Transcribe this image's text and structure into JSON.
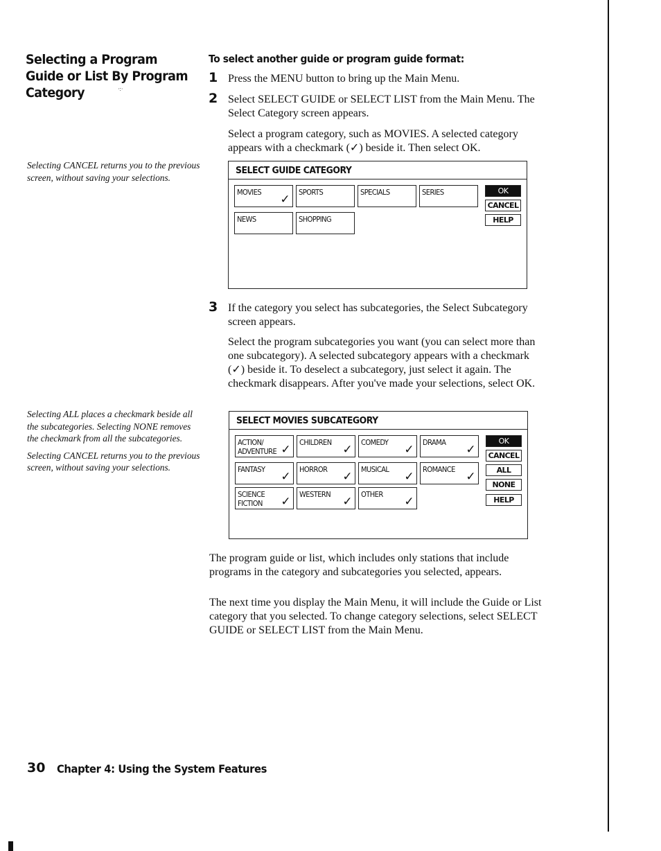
{
  "sidebar": {
    "title": "Selecting a Program Guide or List By Program Category",
    "note_cancel_1": "Selecting CANCEL returns you to the previous screen, without saving your selections.",
    "note_all_none": "Selecting ALL places a checkmark beside all the subcategories. Selecting NONE removes the checkmark from all the subcategories.",
    "note_cancel_2": "Selecting CANCEL returns you to the previous screen, without saving your selections."
  },
  "main": {
    "subhead": "To select another guide or program guide format:",
    "steps": [
      {
        "num": "1",
        "text": "Press the MENU button to bring up the Main Menu."
      },
      {
        "num": "2",
        "text": "Select SELECT GUIDE or SELECT LIST from the Main Menu. The Select Category screen appears."
      },
      {
        "num": "3",
        "text": "If the category you select has subcategories, the Select Subcategory screen appears."
      }
    ],
    "step2_detail": "Select a program category, such as MOVIES. A selected category appears with a checkmark (✓) beside it. Then select OK.",
    "step3_detail": "Select the program subcategories you want (you can select more than one subcategory). A selected subcategory appears with a checkmark (✓) beside it. To deselect a subcategory, just select it again. The checkmark disappears. After you've made your selections, select OK.",
    "result_text": "The program guide or list, which includes only stations that include programs in the category and subcategories you selected, appears.",
    "next_time_text": "The next time you display the Main Menu, it will include the Guide or List category that you selected. To change category selections, select SELECT GUIDE or SELECT LIST from the Main Menu."
  },
  "guide_screen": {
    "title": "SELECT GUIDE CATEGORY",
    "categories": [
      {
        "label": "MOVIES",
        "checked": true
      },
      {
        "label": "SPORTS",
        "checked": false
      },
      {
        "label": "SPECIALS",
        "checked": false
      },
      {
        "label": "SERIES",
        "checked": false
      },
      {
        "label": "NEWS",
        "checked": false
      },
      {
        "label": "SHOPPING",
        "checked": false
      }
    ],
    "buttons": {
      "ok": "OK",
      "cancel": "CANCEL",
      "help": "HELP"
    }
  },
  "subcategory_screen": {
    "title": "SELECT MOVIES SUBCATEGORY",
    "subcategories": [
      {
        "label": "ACTION/\nADVENTURE",
        "checked": true
      },
      {
        "label": "CHILDREN",
        "checked": true
      },
      {
        "label": "COMEDY",
        "checked": true
      },
      {
        "label": "DRAMA",
        "checked": true
      },
      {
        "label": "FANTASY",
        "checked": true
      },
      {
        "label": "HORROR",
        "checked": true
      },
      {
        "label": "MUSICAL",
        "checked": true
      },
      {
        "label": "ROMANCE",
        "checked": true
      },
      {
        "label": "SCIENCE\nFICTION",
        "checked": true
      },
      {
        "label": "WESTERN",
        "checked": true
      },
      {
        "label": "OTHER",
        "checked": true
      }
    ],
    "buttons": {
      "ok": "OK",
      "cancel": "CANCEL",
      "all": "ALL",
      "none": "NONE",
      "help": "HELP"
    }
  },
  "icons": {
    "checkmark": "✓"
  },
  "footer": {
    "page_number": "30",
    "chapter_title": "Chapter 4: Using the System Features"
  }
}
